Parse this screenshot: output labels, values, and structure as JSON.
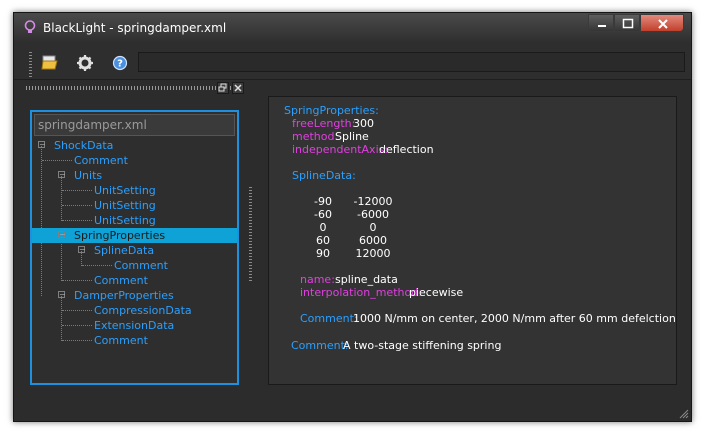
{
  "window": {
    "title": "BlackLight - springdamper.xml"
  },
  "toolbar": {
    "open_icon": "open-folder-icon",
    "settings_icon": "gear-icon",
    "help_icon": "help-icon",
    "field_value": ""
  },
  "tree": {
    "header": "springdamper.xml",
    "items": [
      {
        "label": "ShockData",
        "depth": 0,
        "expander": "−"
      },
      {
        "label": "Comment",
        "depth": 1
      },
      {
        "label": "Units",
        "depth": 1,
        "expander": "−"
      },
      {
        "label": "UnitSetting",
        "depth": 2
      },
      {
        "label": "UnitSetting",
        "depth": 2
      },
      {
        "label": "UnitSetting",
        "depth": 2
      },
      {
        "label": "SpringProperties",
        "depth": 1,
        "expander": "−",
        "selected": true
      },
      {
        "label": "SplineData",
        "depth": 2,
        "expander": "−"
      },
      {
        "label": "Comment",
        "depth": 3
      },
      {
        "label": "Comment",
        "depth": 2
      },
      {
        "label": "DamperProperties",
        "depth": 1,
        "expander": "−"
      },
      {
        "label": "CompressionData",
        "depth": 2
      },
      {
        "label": "ExtensionData",
        "depth": 2
      },
      {
        "label": "Comment",
        "depth": 2
      }
    ]
  },
  "details": {
    "heading": "SpringProperties:",
    "attrs": [
      {
        "key": "freeLength:",
        "value": "300"
      },
      {
        "key": "method:",
        "value": "Spline"
      },
      {
        "key": "independentAxis:",
        "value": "deflection"
      }
    ],
    "spline_heading": "SplineData:",
    "spline_rows": [
      [
        "-90",
        "-12000"
      ],
      [
        "-60",
        "-6000"
      ],
      [
        "0",
        "0"
      ],
      [
        "60",
        "6000"
      ],
      [
        "90",
        "12000"
      ]
    ],
    "spline_attrs": [
      {
        "key": "name:",
        "value": "spline_data"
      },
      {
        "key": "interpolation_method:",
        "value": "piecewise"
      }
    ],
    "spline_comment_key": "Comment:",
    "spline_comment_value": "1000 N/mm on center, 2000 N/mm after 60 mm defelction",
    "comment_key": "Comment:",
    "comment_value": "A two-stage stiffening spring"
  },
  "colors": {
    "accent": "#2aa0ff",
    "attribute": "#e040e0",
    "selection": "#0ea2d6",
    "background": "#2c2c2c"
  }
}
